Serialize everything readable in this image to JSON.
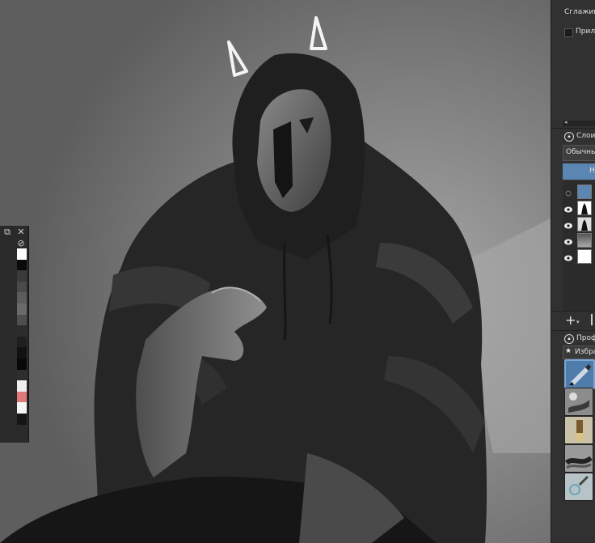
{
  "tool_options": {
    "smoothing_label": "Сглажива",
    "snap_label": "Прил"
  },
  "layers": {
    "title": "Слои",
    "blend_mode": "Обычны",
    "tab_label": "Н",
    "rows": [
      {
        "name": "layer-row-group",
        "visible": false
      },
      {
        "name": "layer-row-figure",
        "visible": true
      },
      {
        "name": "layer-row-figure-2",
        "visible": true
      },
      {
        "name": "layer-row-gradient",
        "visible": true
      },
      {
        "name": "layer-row-white",
        "visible": true
      }
    ]
  },
  "brush_presets": {
    "title": "Проф",
    "favorites_label": "Избра"
  },
  "palette": {
    "colors": [
      "#ffffff",
      "#0a0a0a",
      "#3a3a3a",
      "#4a4a4a",
      "#5c5c5c",
      "#6a6a6a",
      "#4e4e4e",
      "#2c2c2c",
      "#1f1f1f",
      "#121212",
      "#080808",
      "#2e2e2e",
      "#f0f0f0",
      "#e07a7a",
      "#f5f5f5",
      "#151515"
    ]
  },
  "colors": {
    "panel_bg": "#313131",
    "accent": "#5b86b2",
    "canvas_bg": "#7a7a7a"
  },
  "icons": {
    "float": "float-window-icon",
    "close": "close-icon",
    "no_color": "no-color-icon",
    "add_layer": "plus-icon",
    "lock": "lock-icon",
    "star": "star-icon",
    "eye": "eye-icon"
  }
}
